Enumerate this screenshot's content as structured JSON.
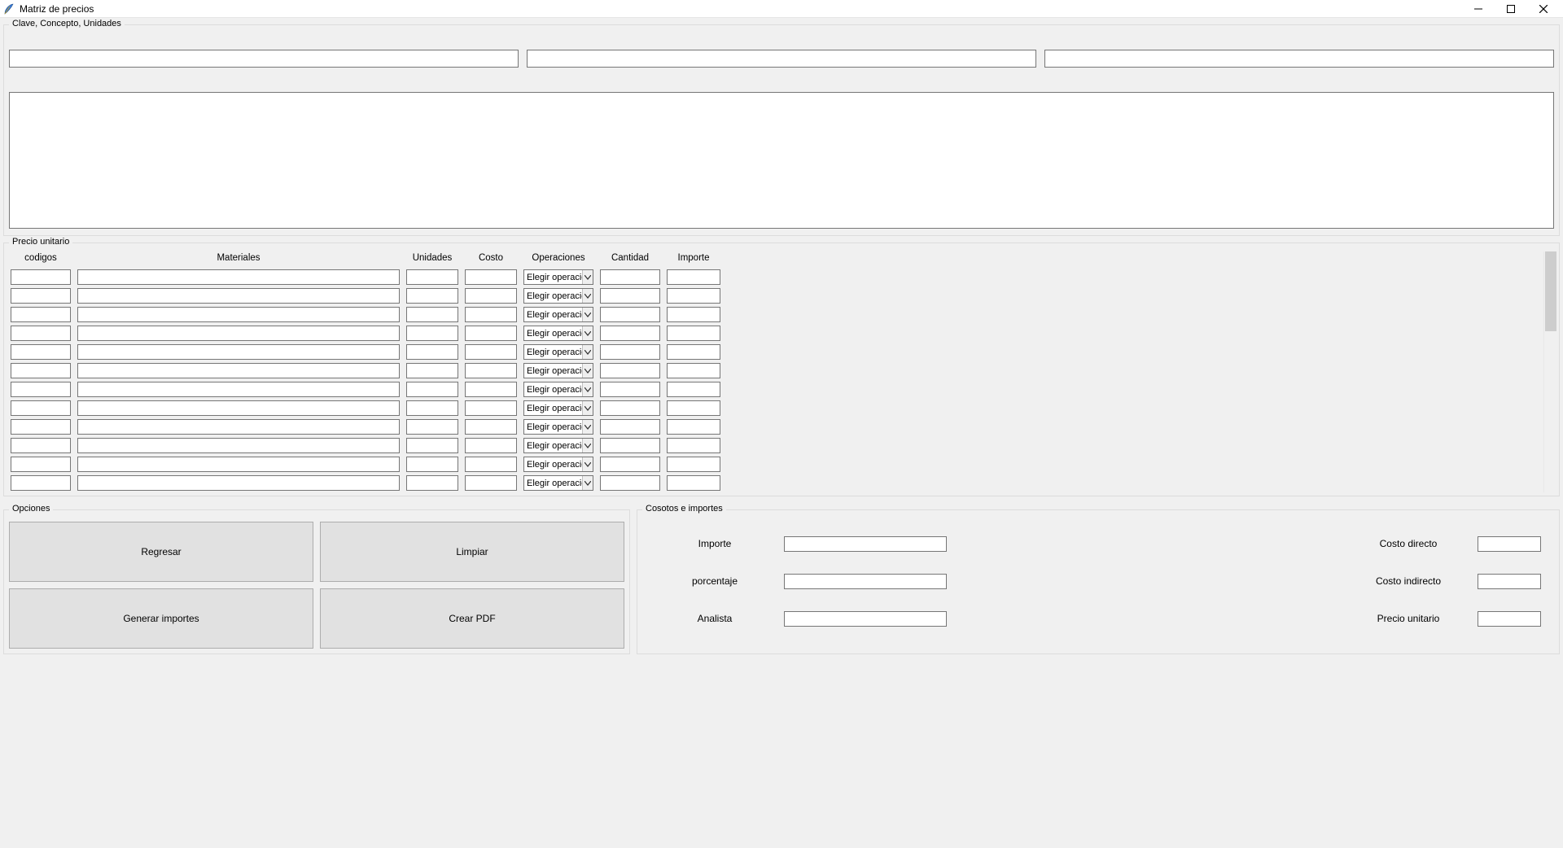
{
  "window": {
    "title": "Matriz de precios"
  },
  "groups": {
    "top": "Clave, Concepto, Unidades",
    "pu": "Precio unitario",
    "opts": "Opciones",
    "cost": "Cosotos e importes"
  },
  "top_inputs": {
    "clave": "",
    "concepto": "",
    "unidades": "",
    "textarea": ""
  },
  "pu_headers": {
    "codigos": "codigos",
    "materiales": "Materiales",
    "unidades": "Unidades",
    "costo": "Costo",
    "operaciones": "Operaciones",
    "cantidad": "Cantidad",
    "importe": "Importe"
  },
  "pu_combo_default": "Elegir operación",
  "pu_rows": [
    {
      "codigo": "",
      "material": "",
      "unidad": "",
      "costo": "",
      "operacion": "Elegir operación",
      "cantidad": "",
      "importe": ""
    },
    {
      "codigo": "",
      "material": "",
      "unidad": "",
      "costo": "",
      "operacion": "Elegir operación",
      "cantidad": "",
      "importe": ""
    },
    {
      "codigo": "",
      "material": "",
      "unidad": "",
      "costo": "",
      "operacion": "Elegir operación",
      "cantidad": "",
      "importe": ""
    },
    {
      "codigo": "",
      "material": "",
      "unidad": "",
      "costo": "",
      "operacion": "Elegir operación",
      "cantidad": "",
      "importe": ""
    },
    {
      "codigo": "",
      "material": "",
      "unidad": "",
      "costo": "",
      "operacion": "Elegir operación",
      "cantidad": "",
      "importe": ""
    },
    {
      "codigo": "",
      "material": "",
      "unidad": "",
      "costo": "",
      "operacion": "Elegir operación",
      "cantidad": "",
      "importe": ""
    },
    {
      "codigo": "",
      "material": "",
      "unidad": "",
      "costo": "",
      "operacion": "Elegir operación",
      "cantidad": "",
      "importe": ""
    },
    {
      "codigo": "",
      "material": "",
      "unidad": "",
      "costo": "",
      "operacion": "Elegir operación",
      "cantidad": "",
      "importe": ""
    },
    {
      "codigo": "",
      "material": "",
      "unidad": "",
      "costo": "",
      "operacion": "Elegir operación",
      "cantidad": "",
      "importe": ""
    },
    {
      "codigo": "",
      "material": "",
      "unidad": "",
      "costo": "",
      "operacion": "Elegir operación",
      "cantidad": "",
      "importe": ""
    },
    {
      "codigo": "",
      "material": "",
      "unidad": "",
      "costo": "",
      "operacion": "Elegir operación",
      "cantidad": "",
      "importe": ""
    },
    {
      "codigo": "",
      "material": "",
      "unidad": "",
      "costo": "",
      "operacion": "Elegir operación",
      "cantidad": "",
      "importe": ""
    }
  ],
  "options": {
    "regresar": "Regresar",
    "limpiar": "Limpiar",
    "generar": "Generar importes",
    "pdf": "Crear PDF"
  },
  "cost": {
    "labels": {
      "importe": "Importe",
      "porcentaje": "porcentaje",
      "analista": "Analista",
      "costo_directo": "Costo directo",
      "costo_indirecto": "Costo indirecto",
      "precio_unitario": "Precio unitario"
    },
    "values": {
      "importe": "",
      "porcentaje": "",
      "analista": "",
      "costo_directo": "",
      "costo_indirecto": "",
      "precio_unitario": ""
    }
  }
}
